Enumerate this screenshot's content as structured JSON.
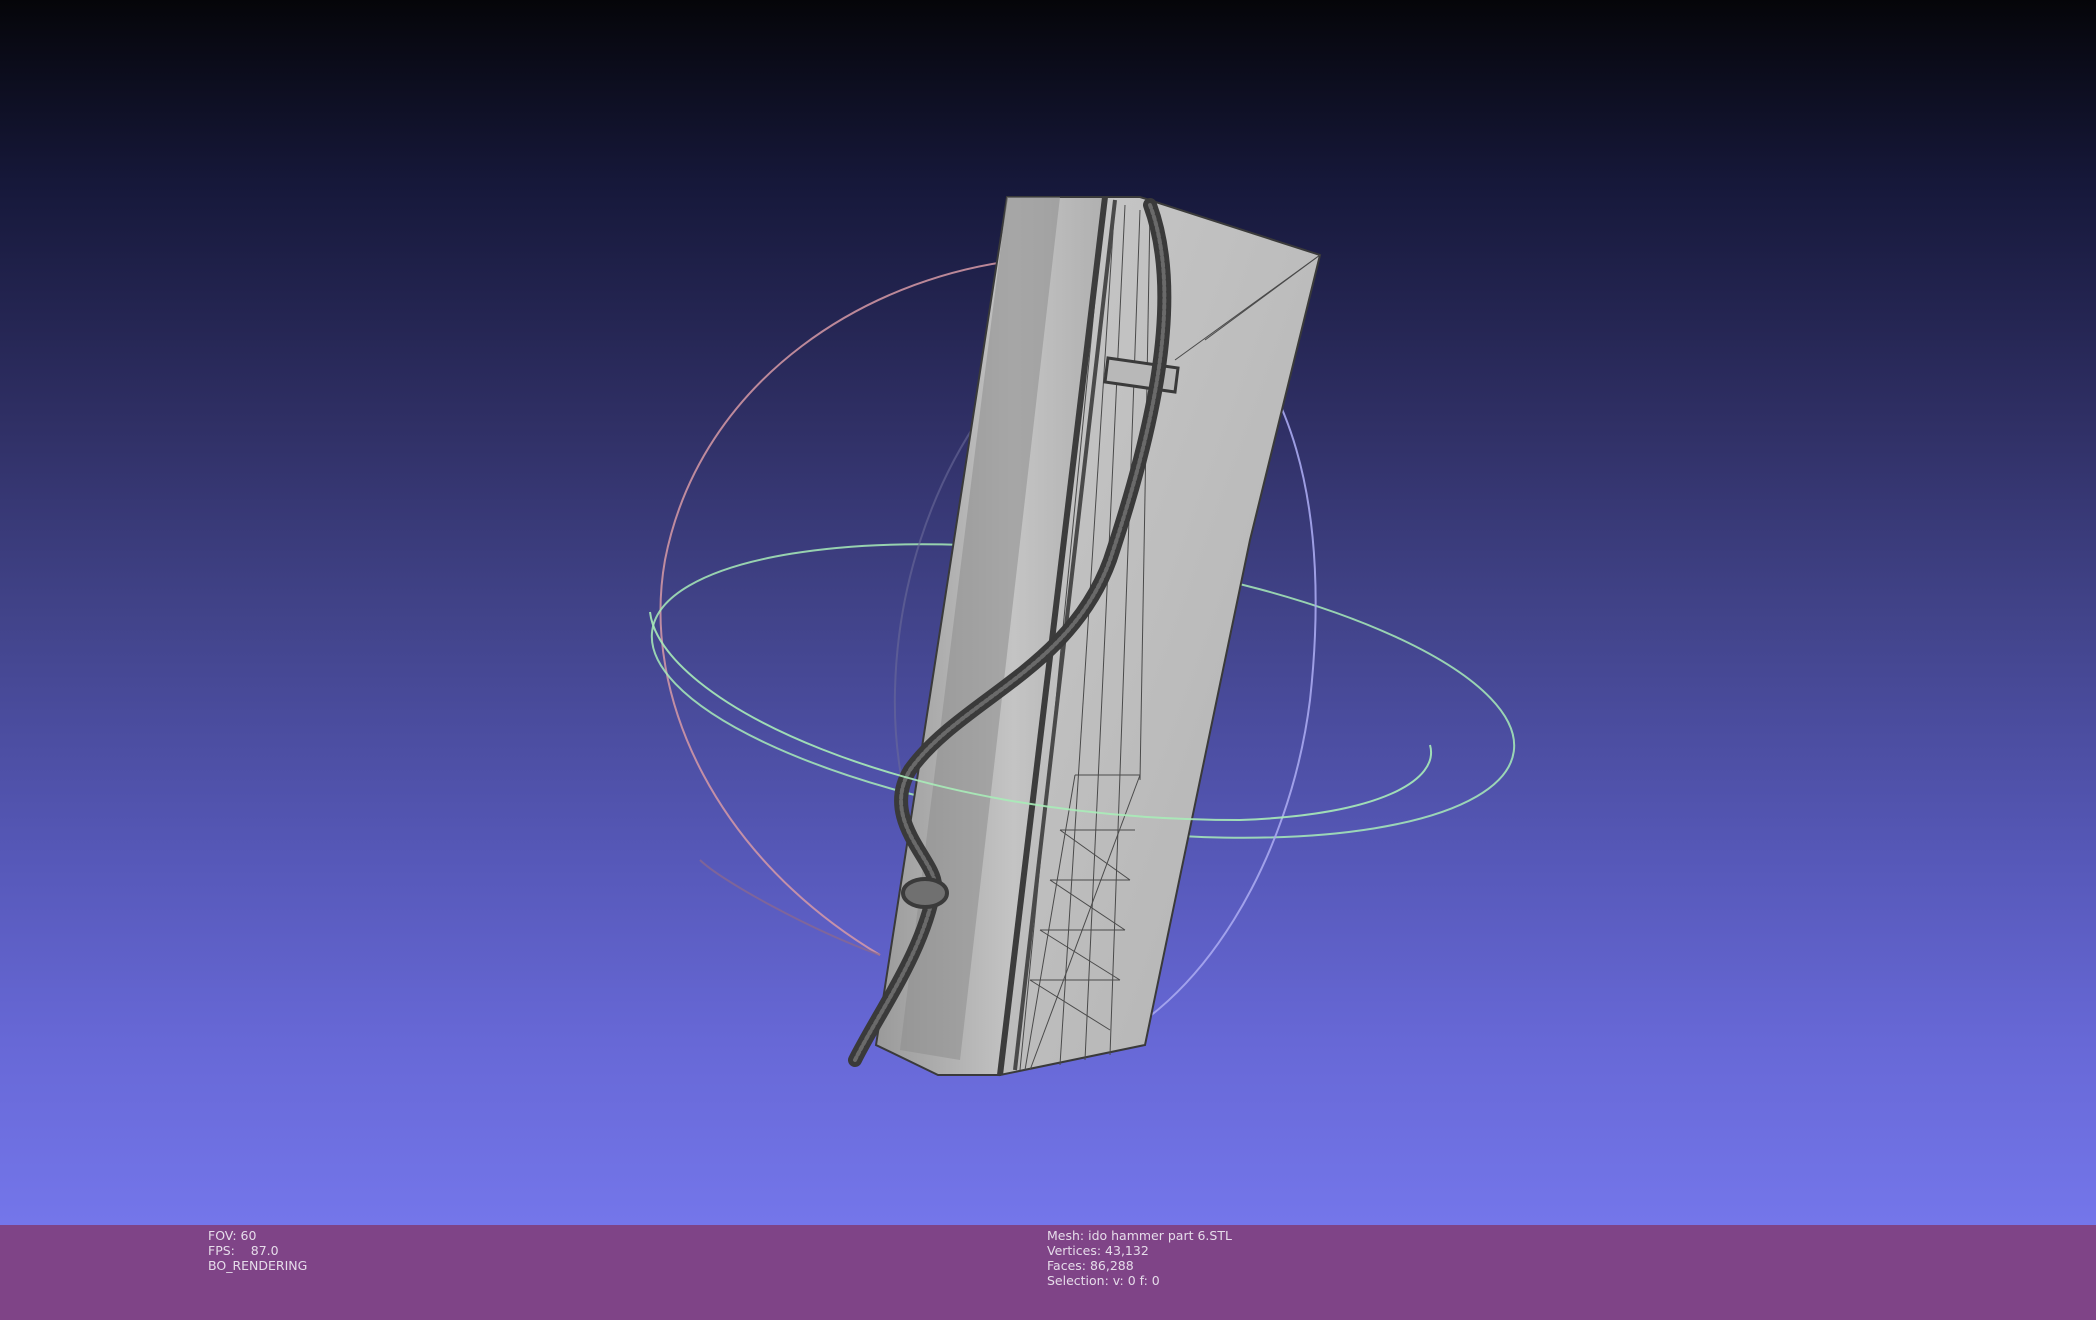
{
  "viewport": {
    "background_top": "#050509",
    "background_bottom": "#7476ea"
  },
  "status_bar": {
    "background": "#7f4487",
    "render_info": {
      "fov": "FOV: 60",
      "fps": "FPS:    87.0",
      "mode": "BO_RENDERING"
    },
    "mesh_info": {
      "mesh": "Mesh: ido hammer part 6.STL",
      "vertices": "Vertices: 43,132",
      "faces": "Faces: 86,288",
      "selection": "Selection: v: 0 f: 0"
    }
  },
  "trackball": {
    "x_ring_color": "#d79aa6",
    "y_ring_color": "#a8ecb8",
    "z_ring_color": "#a8a8f0"
  },
  "mesh": {
    "face_color": "#bdbdbd",
    "shade_color": "#8e8e8e",
    "edge_color": "#3a3a3a"
  }
}
